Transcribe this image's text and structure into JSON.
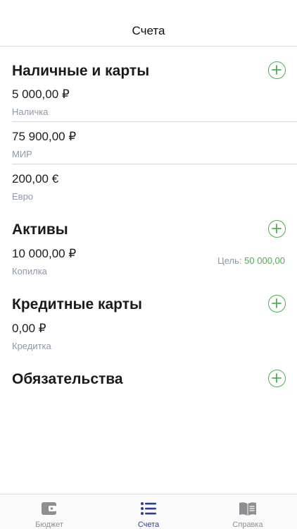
{
  "header": {
    "title": "Счета"
  },
  "sections": [
    {
      "title": "Наличные и карты",
      "rows": [
        {
          "amount": "5 000,00 ₽",
          "label": "Наличка"
        },
        {
          "amount": "75 900,00 ₽",
          "label": "МИР"
        },
        {
          "amount": "200,00 €",
          "label": "Евро"
        }
      ]
    },
    {
      "title": "Активы",
      "rows": [
        {
          "amount": "10 000,00 ₽",
          "label": "Копилка",
          "goal_label": "Цель:",
          "goal_value": "50 000,00"
        }
      ]
    },
    {
      "title": "Кредитные карты",
      "rows": [
        {
          "amount": "0,00 ₽",
          "label": "Кредитка"
        }
      ]
    },
    {
      "title": "Обязательства",
      "rows": []
    }
  ],
  "tabs": [
    {
      "label": "Бюджет",
      "icon": "wallet-icon",
      "active": false
    },
    {
      "label": "Счета",
      "icon": "list-icon",
      "active": true
    },
    {
      "label": "Справка",
      "icon": "book-icon",
      "active": false
    }
  ],
  "colors": {
    "accent_green": "#4caf50",
    "active_tab": "#2c3e8f",
    "secondary_text": "#8e98a8"
  }
}
